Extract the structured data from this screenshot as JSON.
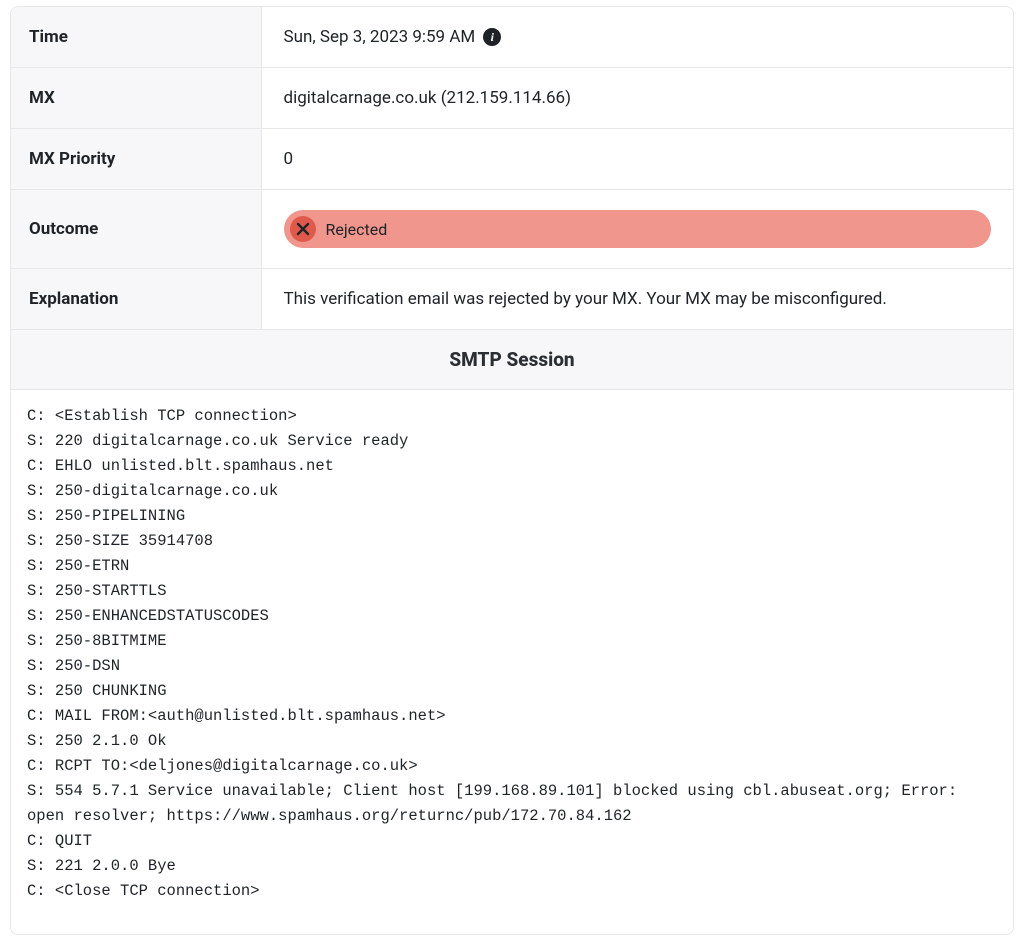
{
  "rows": {
    "time": {
      "label": "Time",
      "value": "Sun, Sep 3, 2023 9:59 AM"
    },
    "mx": {
      "label": "MX",
      "value": "digitalcarnage.co.uk (212.159.114.66)"
    },
    "mx_priority": {
      "label": "MX Priority",
      "value": "0"
    },
    "outcome": {
      "label": "Outcome",
      "status": "Rejected"
    },
    "explanation": {
      "label": "Explanation",
      "value": "This verification email was rejected by your MX. Your MX may be misconfigured."
    }
  },
  "session": {
    "title": "SMTP Session",
    "log": "C: <Establish TCP connection>\nS: 220 digitalcarnage.co.uk Service ready\nC: EHLO unlisted.blt.spamhaus.net\nS: 250-digitalcarnage.co.uk\nS: 250-PIPELINING\nS: 250-SIZE 35914708\nS: 250-ETRN\nS: 250-STARTTLS\nS: 250-ENHANCEDSTATUSCODES\nS: 250-8BITMIME\nS: 250-DSN\nS: 250 CHUNKING\nC: MAIL FROM:<auth@unlisted.blt.spamhaus.net>\nS: 250 2.1.0 Ok\nC: RCPT TO:<deljones@digitalcarnage.co.uk>\nS: 554 5.7.1 Service unavailable; Client host [199.168.89.101] blocked using cbl.abuseat.org; Error: open resolver; https://www.spamhaus.org/returnc/pub/172.70.84.162\nC: QUIT\nS: 221 2.0.0 Bye\nC: <Close TCP connection>"
  }
}
